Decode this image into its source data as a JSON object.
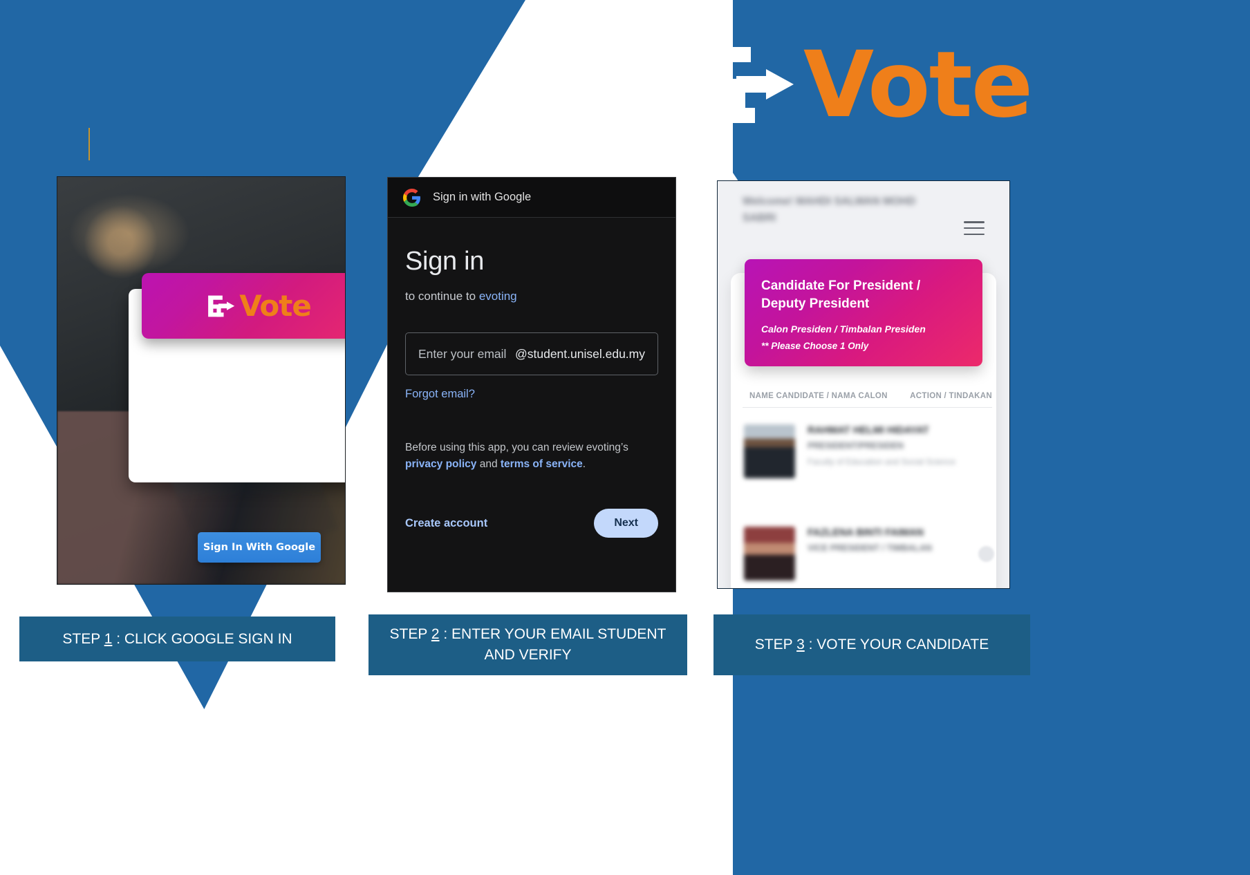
{
  "brand": {
    "logo_e": "E",
    "logo_vote": "Vote",
    "colors": {
      "blue": "#2167a5",
      "orange": "#ef7f1a",
      "caption_bar": "#1d5e86",
      "magenta": "#c3149c",
      "google_blue": "#8ab4f8"
    }
  },
  "panel_one": {
    "banner_logo_e": "E",
    "banner_logo_vote": "Vote",
    "google_button": "Sign In With Google"
  },
  "panel_two": {
    "header_title": "Sign in with Google",
    "title": "Sign in",
    "continue_prefix": "to continue to ",
    "continue_app": "evoting",
    "email_placeholder": "Enter your email",
    "email_domain": "@student.unisel.edu.my",
    "forgot_email": "Forgot email?",
    "legal_prefix": "Before using this app, you can review evoting’s ",
    "legal_privacy": "privacy policy",
    "legal_and": " and ",
    "legal_terms": "terms of service",
    "legal_end": ".",
    "create_account": "Create account",
    "next_button": "Next"
  },
  "panel_three": {
    "welcome": "Welcome! MAHDI SALWAN MOHD SABRI",
    "hero_title": "Candidate For President / Deputy President",
    "hero_subtitle": "Calon Presiden / Timbalan Presiden",
    "hero_note": "** Please Choose 1 Only",
    "col_name": "NAME CANDIDATE / NAMA CALON",
    "col_action": "ACTION / TINDAKAN",
    "candidates": [
      {
        "name": "RAHMAT HELMI HIDAYAT",
        "post": "PRESIDENT/PRESIDEN",
        "faculty": "Faculty of Education and Social Science"
      },
      {
        "name": "FAZLENA BINTI FAIMAN",
        "post": "VICE PRESIDENT / TIMBALAN",
        "faculty": ""
      }
    ]
  },
  "steps": [
    {
      "label_prefix": "STEP ",
      "number": "1",
      "label_suffix": " : CLICK GOOGLE SIGN IN"
    },
    {
      "label_prefix": "STEP ",
      "number": "2",
      "label_suffix": " :  ENTER YOUR EMAIL STUDENT AND VERIFY"
    },
    {
      "label_prefix": "STEP ",
      "number": "3",
      "label_suffix": " :  VOTE YOUR CANDIDATE"
    }
  ]
}
